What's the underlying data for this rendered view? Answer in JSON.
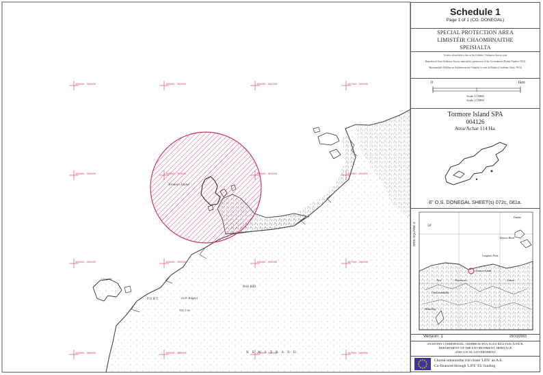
{
  "map": {
    "grid_labels": [
      "154000 , 392000",
      "155000 , 392000",
      "156000 , 392000",
      "157000 , 392000",
      "154000 , 391000",
      "155000 , 391000",
      "156000 , 391000",
      "157000 , 391000",
      "154000 , 390000",
      "155000 , 390000",
      "156000 , 390000",
      "157000 , 390000",
      "154000 , 389000",
      "155000 , 389000",
      "156000 , 389000",
      "157000 , 389000"
    ],
    "island_label": "Tormore Island",
    "place_labels": {
      "port_hill": "Port Hill",
      "port": "P O R T",
      "bench_mark": "(S.D. Bdgdy)",
      "sheet_nums": "330   1   36",
      "crosgaile": "Crosgaile",
      "strand": "N E W S T R A N D"
    },
    "spa_color": "#cc3366"
  },
  "panel": {
    "schedule_title": "Schedule 1",
    "page_info": "Page 1 of 1 (CO. DONEGAL)",
    "spa_en": "SPECIAL PROTECTION AREA",
    "spa_ga_1": "LIMISTÉIR CHAOMHNAITHE",
    "spa_ga_2": "SPEISIALTA",
    "copyright_1": "Tosaíse oifeachiúil a chur ar An Ordnáis / Ordnance Survey note",
    "copyright_2": "Reproduced from Ordnance Survey material by permission of the Government (Permit Number 5914)",
    "copyright_3": "Macasamhail d'léibhar na Suirbhéireachta Ordanáis le cead ón Rialtas (Ceadúnas Uimh. 5914)",
    "scale_zero": "0",
    "scale_end": "1km",
    "scale_1": "Scale 1:15000",
    "scale_2": "Scála 1:15000",
    "site_name": "Tormore Island SPA",
    "site_code": "004126",
    "site_area": "Area/Achar 114 Ha.",
    "os_sheets": "6\" O.S. DONEGAL  SHEET(s) 072c, 081a.",
    "inset_grid_label": "GRID SQUARE G",
    "inset_lat": "50'",
    "inset_places": {
      "dunlee": "Dunlee",
      "dawros_head": "Dawros Head",
      "loughros_point": "Loughros Point",
      "tormore_island": "Tormore Island",
      "slieve": "Slievetooey",
      "ardara": "Ardara",
      "glencolmcille": "Glencolumbkille",
      "port": "Port",
      "malin_beg": "Malin Beg"
    },
    "version": "Version: 1",
    "date": "29/10/2003",
    "dept_1": "AN ROINN COMHSHAOIL, OIDHREACHTA AGUS RIALTAIS ÁITIÚIL",
    "dept_2": "DEPARTMENT OF THE ENVIRONMENT, HERITAGE",
    "dept_3": "AND LOCAL GOVERNMENT",
    "eu_1": "Chomh-mhaoinithe tríd chiste 'LIFE' an A.E.",
    "eu_2": "Co-financed through 'LIFE' EU funding",
    "eu_flag_color": "#3d3598"
  }
}
